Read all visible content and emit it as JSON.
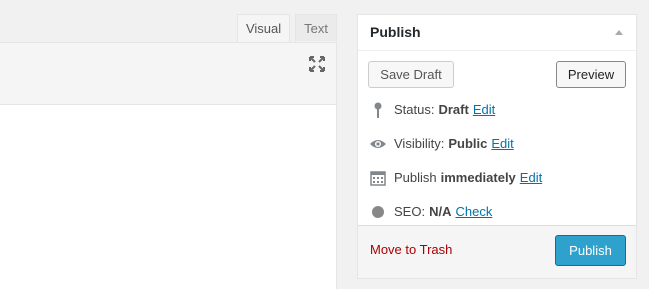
{
  "editor": {
    "tabs": [
      {
        "label": "Visual",
        "active": true
      },
      {
        "label": "Text",
        "active": false
      }
    ],
    "fullscreen_icon": "expand-icon"
  },
  "publish": {
    "title": "Publish",
    "save_draft": "Save Draft",
    "preview": "Preview",
    "status": {
      "label": "Status:",
      "value": "Draft",
      "edit": "Edit",
      "icon": "pin-icon"
    },
    "visibility": {
      "label": "Visibility:",
      "value": "Public",
      "edit": "Edit",
      "icon": "eye-icon"
    },
    "schedule": {
      "label": "Publish",
      "value": "immediately",
      "edit": "Edit",
      "icon": "calendar-icon"
    },
    "seo": {
      "label": "SEO:",
      "value": "N/A",
      "edit": "Check",
      "icon": "seo-dot-icon"
    },
    "move_to_trash": "Move to Trash",
    "publish_button": "Publish"
  },
  "colors": {
    "link": "#0073aa",
    "trash": "#aa0000",
    "publish_button": "#2ea2cc"
  }
}
